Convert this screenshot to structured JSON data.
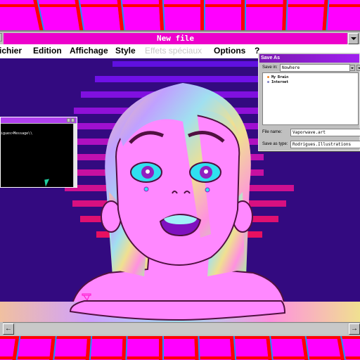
{
  "window": {
    "title": "New file"
  },
  "menu": [
    {
      "label": "Fichier",
      "display": "ichier",
      "accel": "F",
      "enabled": true
    },
    {
      "label": "Edition",
      "accel": "E",
      "enabled": true
    },
    {
      "label": "Affichage",
      "accel": "A",
      "enabled": true
    },
    {
      "label": "Style",
      "accel": "S",
      "enabled": true
    },
    {
      "label": "Effets spéciaux",
      "enabled": false
    },
    {
      "label": "Options",
      "accel": "O",
      "enabled": true
    },
    {
      "label": "?",
      "enabled": true
    }
  ],
  "save_dialog": {
    "title": "Save As",
    "save_in_label": "Save in:",
    "save_in_value": "Nowhere",
    "items": [
      {
        "label": "My Brain",
        "icon": "brain-icon"
      },
      {
        "label": "Internet",
        "icon": "globe-icon"
      }
    ],
    "filename_label": "File name:",
    "filename_value": "Vaporwave.art",
    "type_label": "Save as type:",
    "type_value": "Rodrigues.Illustrations"
  },
  "console": {
    "text": "igues>Message\\\\"
  },
  "scrollbar": {
    "left_icon": "arrow-left-icon",
    "right_icon": "arrow-right-icon",
    "left_glyph": "←",
    "right_glyph": "→"
  },
  "colors": {
    "grid_bg": "#ff00ff",
    "grid_line": "#ff0000",
    "grid_accent": "#1e90ff",
    "title_bar": "#ee00cc",
    "canvas_bg": "#330a80",
    "skin": "#ff88ff",
    "eye": "#30e0f0"
  }
}
